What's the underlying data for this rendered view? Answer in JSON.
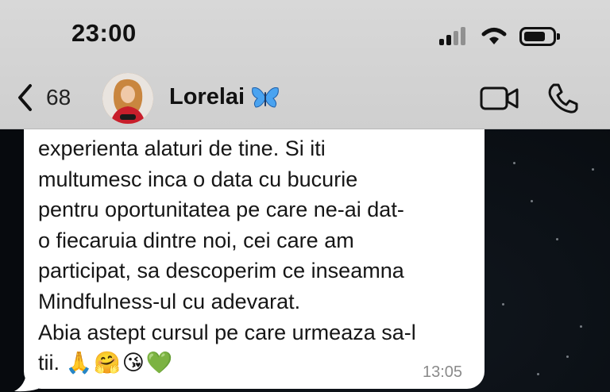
{
  "status_bar": {
    "time": "23:00"
  },
  "chat_header": {
    "back_count": "68",
    "contact_name": "Lorelai",
    "name_emoji": "butterfly"
  },
  "message": {
    "lines": [
      "experienta alaturi de tine. Si iti",
      "multumesc inca o data cu bucurie",
      "pentru oportunitatea pe care ne-ai dat-",
      "o fiecaruia dintre noi, cei care am",
      "participat, sa descoperim ce inseamna",
      "Mindfulness-ul cu adevarat.",
      "Abia astept cursul pe care urmeaza sa-l",
      "tii."
    ],
    "emojis": "🙏🤗😘💚",
    "time": "13:05",
    "bubble_color": "#ffffff"
  },
  "theme": {
    "header_bg": "#d6d6d6",
    "chat_bg": "#0b0f14"
  }
}
